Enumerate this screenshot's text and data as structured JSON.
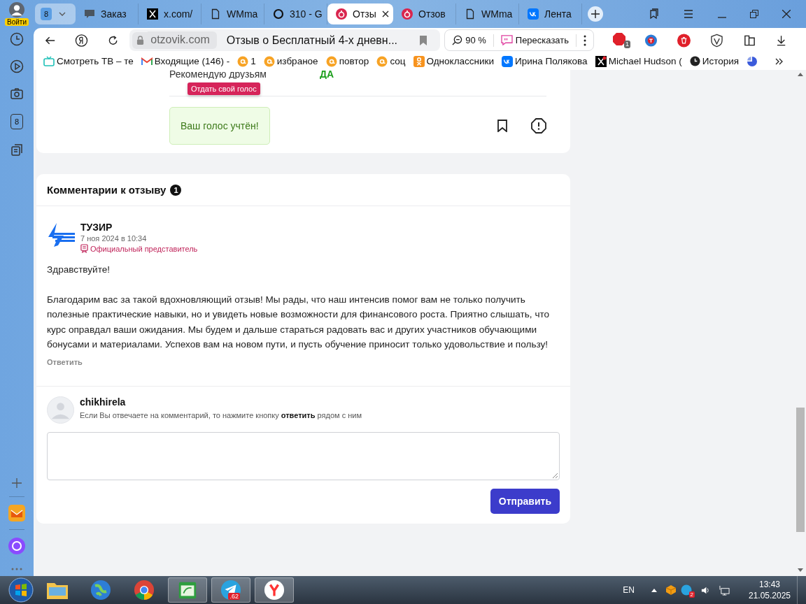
{
  "browser": {
    "profile": {
      "label": "Войти"
    },
    "tab_group": {
      "count": "8"
    },
    "tabs": [
      {
        "title": "Заказ",
        "kind": "sms",
        "selected": false
      },
      {
        "title": "x.com/",
        "kind": "x",
        "selected": false
      },
      {
        "title": "WMma",
        "kind": "doc",
        "selected": false
      },
      {
        "title": "310 - G",
        "kind": "ring",
        "selected": false
      },
      {
        "title": "Отзы",
        "kind": "otzovik",
        "selected": true
      },
      {
        "title": "Отзов",
        "kind": "otzovik",
        "selected": false
      },
      {
        "title": "WMma",
        "kind": "doc",
        "selected": false
      },
      {
        "title": "Лента",
        "kind": "vk",
        "selected": false
      }
    ]
  },
  "toolbar": {
    "domain": "otzovik.com",
    "page_title": "Отзыв о Бесплатный 4-х дневн...",
    "zoom": "90 %",
    "retell": "Пересказать",
    "adblock_badge": "1"
  },
  "bookmarks": [
    {
      "label": "Смотреть ТВ – те",
      "kind": "tv"
    },
    {
      "label": "Входящие (146) -",
      "kind": "gmail"
    },
    {
      "label": "1",
      "kind": "at"
    },
    {
      "label": "избраное",
      "kind": "at"
    },
    {
      "label": "повтор",
      "kind": "at"
    },
    {
      "label": "соц",
      "kind": "at"
    },
    {
      "label": "Одноклассники",
      "kind": "ok"
    },
    {
      "label": "Ирина Полякова",
      "kind": "vk"
    },
    {
      "label": "Michael Hudson (",
      "kind": "x"
    },
    {
      "label": "История",
      "kind": "clock"
    }
  ],
  "sidebar": {
    "badge": "8"
  },
  "review": {
    "recommend_label": "Рекомендую друзьям",
    "recommend_value": "ДА",
    "tooltip": "Отдать свой голос",
    "vote_message": "Ваш голос учтён!"
  },
  "comments": {
    "title": "Комментарии к отзыву",
    "count": "1",
    "items": [
      {
        "author": "ТУЗИР",
        "date": "7 ноя 2024 в 10:34",
        "badge": "Официальный представитель",
        "paragraphs": [
          "Здравствуйте!",
          "Благодарим вас за такой вдохновляющий отзыв! Мы рады, что наш интенсив помог вам не только получить полезные практические навыки, но и увидеть новые возможности для финансового роста. Приятно слышать, что курс оправдал ваши ожидания. Мы будем и дальше стараться радовать вас и других участников обучающими бонусами и материалами. Успехов вам на новом пути, и пусть обучение приносит только удовольствие и пользу!"
        ],
        "reply": "Ответить"
      }
    ],
    "form": {
      "user": "chikhirela",
      "hint": "Если Вы отвечаете на комментарий, то нажмите кнопку **ответить** рядом с ним",
      "submit": "Отправить"
    }
  },
  "taskbar": {
    "apps": [
      {
        "kind": "folder",
        "active": false
      },
      {
        "kind": "globe",
        "active": false
      },
      {
        "kind": "chrome",
        "active": false
      },
      {
        "kind": "green",
        "active": true
      },
      {
        "kind": "telegram",
        "active": true,
        "badge": ".62"
      },
      {
        "kind": "yandex",
        "active": true
      }
    ],
    "language": "EN",
    "tray_badge": "2",
    "time": "13:43",
    "date": "21.05.2025"
  }
}
